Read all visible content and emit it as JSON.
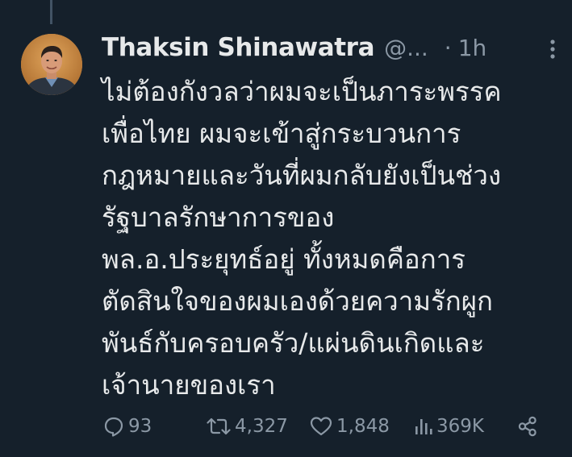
{
  "tweet": {
    "display_name": "Thaksin Shinawatra",
    "handle": "@...",
    "separator": "·",
    "time": "1h",
    "text_lines": [
      "ไม่ต้องกังวลว่าผมจะเป็นภาระพรรค",
      "เพื่อไทย ผมจะเข้าสู่กระบวนการ",
      "กฎหมายและวันที่ผมกลับยังเป็นช่วง",
      "รัฐบาลรักษาการของ",
      "พล.อ.ประยุทธ์อยู่ ทั้งหมดคือการ",
      "ตัดสินใจของผมเองด้วยความรักผูก",
      "พันธ์กับครอบครัว/แผ่นดินเกิดและ",
      "เจ้านายของเรา"
    ]
  },
  "actions": {
    "replies": "93",
    "retweets": "4,327",
    "likes": "1,848",
    "views": "369K"
  },
  "icons": {
    "reply": "reply-icon",
    "retweet": "retweet-icon",
    "like": "heart-icon",
    "views": "views-chart-icon",
    "share": "share-icon",
    "more": "more-vertical-icon"
  },
  "colors": {
    "background": "#15202b",
    "text_primary": "#e7e9ea",
    "text_secondary": "#8b98a5",
    "thread_line": "#425364"
  }
}
